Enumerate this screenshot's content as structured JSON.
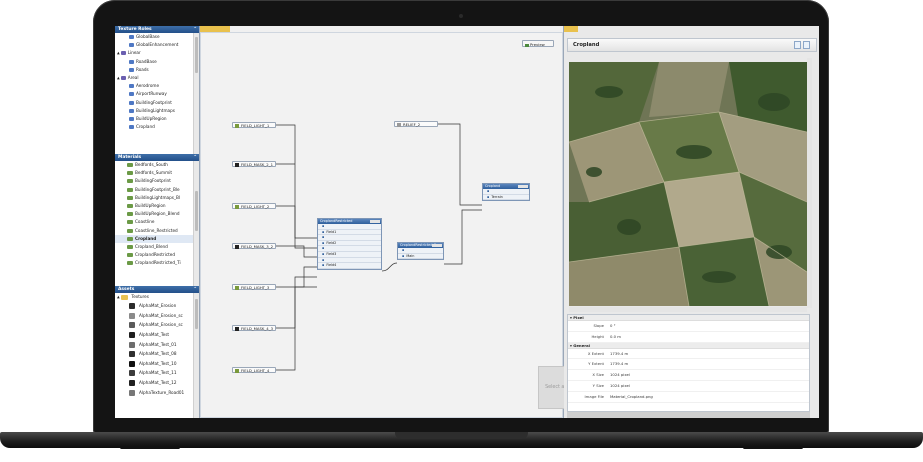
{
  "texture_roles": {
    "title": "Texture Roles",
    "items": [
      {
        "label": "GlobalBase",
        "indent": 2,
        "type": "item"
      },
      {
        "label": "GlobalEnhancement",
        "indent": 2,
        "type": "item"
      },
      {
        "label": "Linear",
        "indent": 0,
        "type": "group",
        "expander": "▲"
      },
      {
        "label": "RoadBase",
        "indent": 2,
        "type": "item"
      },
      {
        "label": "Roads",
        "indent": 2,
        "type": "item"
      },
      {
        "label": "Areal",
        "indent": 0,
        "type": "group",
        "expander": "▲"
      },
      {
        "label": "Aerodrome",
        "indent": 2,
        "type": "item"
      },
      {
        "label": "AirportRunway",
        "indent": 2,
        "type": "item"
      },
      {
        "label": "BuildingFootprint",
        "indent": 2,
        "type": "item"
      },
      {
        "label": "BuildingLightmaps",
        "indent": 2,
        "type": "item"
      },
      {
        "label": "BuildUpRegion",
        "indent": 2,
        "type": "item"
      },
      {
        "label": "Cropland",
        "indent": 2,
        "type": "item"
      }
    ]
  },
  "materials": {
    "title": "Materials",
    "items": [
      {
        "label": "Bedfords_South"
      },
      {
        "label": "Bedfords_Summit"
      },
      {
        "label": "BuildingFootprint"
      },
      {
        "label": "BuildingFootprint_Ble"
      },
      {
        "label": "BuildingLightmaps_Bl"
      },
      {
        "label": "BuildUpRegion"
      },
      {
        "label": "BuildUpRegion_Blend"
      },
      {
        "label": "Coastline"
      },
      {
        "label": "Coastline_Restricted"
      },
      {
        "label": "Cropland",
        "selected": true
      },
      {
        "label": "Cropland_Blend"
      },
      {
        "label": "CroplandRestricted"
      },
      {
        "label": "CroplandRestricted_Ti"
      }
    ]
  },
  "assets": {
    "title": "Assets",
    "folder": "Textures",
    "items": [
      {
        "label": "AlphaMat_Erosion",
        "swatch": "#2b2b2b"
      },
      {
        "label": "AlphaMat_Erosion_sc",
        "swatch": "#8a8a8a"
      },
      {
        "label": "AlphaMat_Erosion_sc",
        "swatch": "#5a5a5a"
      },
      {
        "label": "AlphaMat_Test",
        "swatch": "#1e1e1e"
      },
      {
        "label": "AlphaMat_Test_01",
        "swatch": "#6d6d6d"
      },
      {
        "label": "AlphaMat_Test_08",
        "swatch": "#2f2f2f"
      },
      {
        "label": "AlphaMat_Test_10",
        "swatch": "#101010"
      },
      {
        "label": "AlphaMat_Test_11",
        "swatch": "#3c3c3c"
      },
      {
        "label": "AlphaMat_Test_12",
        "swatch": "#202020"
      },
      {
        "label": "AlphaTexture_Road01",
        "swatch": "#777777"
      }
    ]
  },
  "editor": {
    "preview_label": "Preview",
    "hint": "Select an item to view its properties",
    "inputs": [
      {
        "label": "FIELD_LIGHT_1",
        "icon_color": "#7a9a3c"
      },
      {
        "label": "FIELD_MASK_2_1",
        "icon_color": "#222222"
      },
      {
        "label": "FIELD_LIGHT_2",
        "icon_color": "#7a9a3c"
      },
      {
        "label": "FIELD_MASK_3_2",
        "icon_color": "#222222"
      },
      {
        "label": "FIELD_LIGHT_3",
        "icon_color": "#7a9a3c"
      },
      {
        "label": "FIELD_MASK_4_3",
        "icon_color": "#222222"
      },
      {
        "label": "FIELD_LIGHT_4",
        "icon_color": "#7a9a3c"
      },
      {
        "label": "RELIEF_2",
        "icon_color": "#9a9a9a"
      }
    ],
    "nodes": [
      {
        "title": "Cropland",
        "rows": [
          "",
          "Terrain"
        ]
      },
      {
        "title": "CroplandRestricted",
        "rows": [
          "",
          "Field1",
          "",
          "Field2",
          "",
          "Field3",
          "",
          "Field4"
        ]
      },
      {
        "title": "CroplandRestricted_2",
        "rows": [
          "",
          "Main"
        ]
      }
    ]
  },
  "preview_panel": {
    "title": "Cropland",
    "sections": [
      {
        "title": "Pixel",
        "rows": [
          {
            "key": "Slope",
            "value": "0 °"
          },
          {
            "key": "Height",
            "value": "0.0 m"
          }
        ]
      },
      {
        "title": "General",
        "rows": [
          {
            "key": "X Extent",
            "value": "1739.4 m"
          },
          {
            "key": "Y Extent",
            "value": "1739.4 m"
          },
          {
            "key": "X Size",
            "value": "1024 pixel"
          },
          {
            "key": "Y Size",
            "value": "1024 pixel"
          },
          {
            "key": "Image File",
            "value": "Material_Cropland.png"
          }
        ]
      }
    ]
  }
}
